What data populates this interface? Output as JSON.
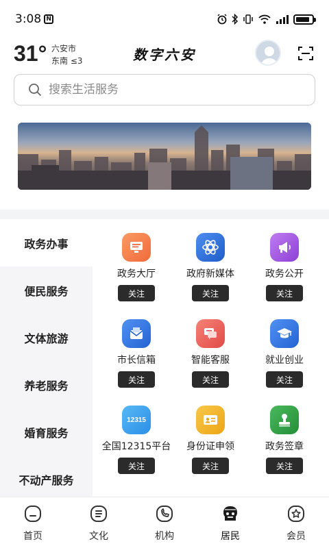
{
  "status_bar": {
    "time": "3:08",
    "nfc_glyph": "N",
    "icons": [
      "alarm-icon",
      "bluetooth-icon",
      "vibrate-icon",
      "wifi-icon",
      "signal-icon",
      "battery-icon"
    ]
  },
  "header": {
    "temperature": "31°",
    "city": "六安市",
    "wind": "东南 ≤3",
    "app_title": "数字六安"
  },
  "search": {
    "placeholder": "搜索生活服务"
  },
  "categories": [
    {
      "label": "政务办事",
      "active": true
    },
    {
      "label": "便民服务",
      "active": false
    },
    {
      "label": "文体旅游",
      "active": false
    },
    {
      "label": "养老服务",
      "active": false
    },
    {
      "label": "婚育服务",
      "active": false
    },
    {
      "label": "不动产服务",
      "active": false
    }
  ],
  "services": [
    {
      "label": "政务大厅",
      "icon": "monitor-icon",
      "color": "#f47b4d",
      "button": "关注"
    },
    {
      "label": "政府新媒体",
      "icon": "network-icon",
      "color": "#2f6fd7",
      "button": "关注"
    },
    {
      "label": "政务公开",
      "icon": "megaphone-icon",
      "color": "#a256e0",
      "button": "关注"
    },
    {
      "label": "市长信箱",
      "icon": "mail-icon",
      "color": "#2f73df",
      "button": "关注"
    },
    {
      "label": "智能客服",
      "icon": "chat-icon",
      "color": "#ea5a56",
      "button": "关注"
    },
    {
      "label": "就业创业",
      "icon": "graduation-cap-icon",
      "color": "#2f73df",
      "button": "关注"
    },
    {
      "label": "全国12315平台",
      "icon": "complaint-12315-icon",
      "icon_text": "12315",
      "color": "#39a5ef",
      "button": "关注"
    },
    {
      "label": "身份证申领",
      "icon": "id-card-icon",
      "color": "#f2b21c",
      "button": "关注"
    },
    {
      "label": "政务签章",
      "icon": "stamp-icon",
      "color": "#2e9a42",
      "button": "关注"
    }
  ],
  "bottom_nav": [
    {
      "label": "首页",
      "icon": "home-icon",
      "active": false
    },
    {
      "label": "文化",
      "icon": "document-icon",
      "active": false
    },
    {
      "label": "机构",
      "icon": "phone-icon",
      "active": false
    },
    {
      "label": "居民",
      "icon": "resident-icon",
      "active": true
    },
    {
      "label": "会员",
      "icon": "member-icon",
      "active": false
    }
  ]
}
